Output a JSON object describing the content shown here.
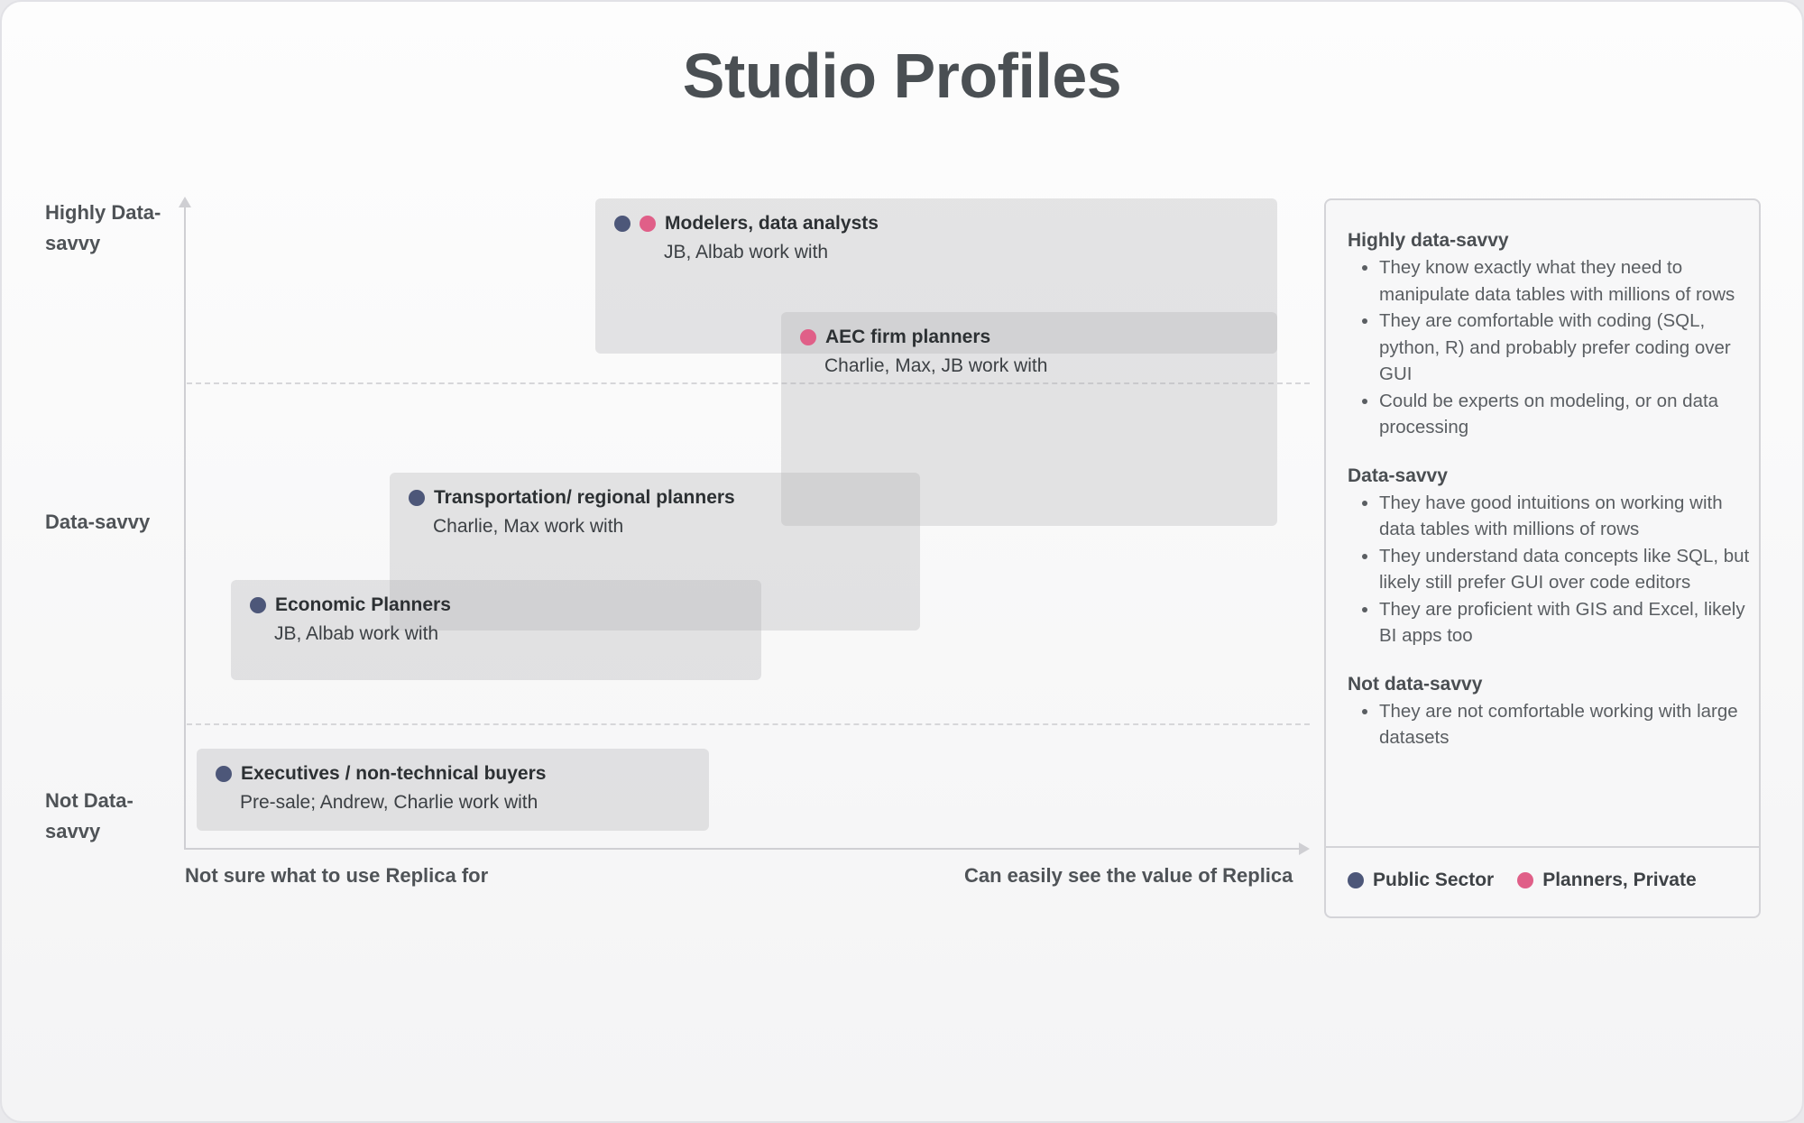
{
  "title": "Studio Profiles",
  "axes": {
    "y_top": "Highly Data-savvy",
    "y_mid": "Data-savvy",
    "y_bottom": "Not Data-savvy",
    "x_left": "Not sure what to use Replica for",
    "x_right": "Can easily see the value of Replica"
  },
  "colors": {
    "public_sector": "#4d5779",
    "planners_private": "#e05f88"
  },
  "profiles": [
    {
      "title": "Modelers, data analysts",
      "sub": "JB, Albab work with",
      "sectors": [
        "public_sector",
        "planners_private"
      ]
    },
    {
      "title": "AEC firm planners",
      "sub": "Charlie, Max, JB work with",
      "sectors": [
        "planners_private"
      ]
    },
    {
      "title": "Transportation/ regional planners",
      "sub": "Charlie, Max work with",
      "sectors": [
        "public_sector"
      ]
    },
    {
      "title": "Economic Planners",
      "sub": "JB, Albab work with",
      "sectors": [
        "public_sector"
      ]
    },
    {
      "title": "Executives / non-technical buyers",
      "sub": "Pre-sale; Andrew, Charlie work with",
      "sectors": [
        "public_sector"
      ]
    }
  ],
  "legend": {
    "sections": [
      {
        "title": "Highly data-savvy",
        "items": [
          "They know exactly what they need to manipulate data tables with millions of rows",
          "They are comfortable with coding (SQL, python, R) and probably prefer coding over GUI",
          "Could be experts on modeling, or on data processing"
        ]
      },
      {
        "title": "Data-savvy",
        "items": [
          "They have good intuitions on working with data tables with millions of rows",
          "They understand data concepts like SQL, but likely still prefer GUI over code editors",
          "They are proficient with GIS and Excel, likely BI apps too"
        ]
      },
      {
        "title": "Not data-savvy",
        "items": [
          "They are not comfortable working with large datasets"
        ]
      }
    ],
    "keys": {
      "public_sector": "Public Sector",
      "planners_private": "Planners, Private"
    }
  }
}
